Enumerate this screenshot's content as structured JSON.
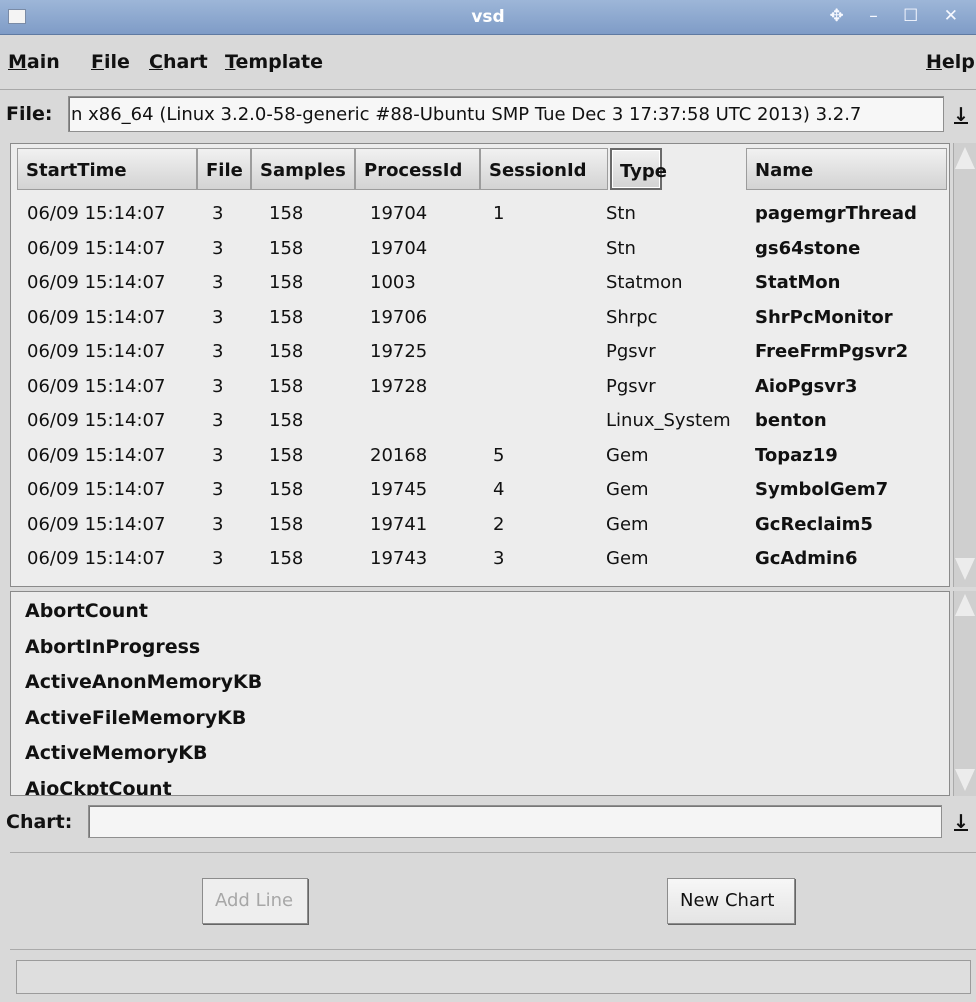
{
  "window": {
    "title": "vsd",
    "controls": "✥ – ☐ ✕",
    "icon": "window-icon"
  },
  "menubar": {
    "items": [
      "Main",
      "File",
      "Chart",
      "Template"
    ],
    "help": "Help"
  },
  "file_selector": {
    "label": "File:",
    "value": "n x86_64 (Linux 3.2.0-58-generic #88-Ubuntu SMP Tue Dec 3 17:37:58 UTC 2013) 3.2.7",
    "drop_icon": "download-arrow-icon"
  },
  "process_table": {
    "columns": [
      "StartTime",
      "File",
      "Samples",
      "ProcessId",
      "SessionId",
      "Type",
      "Name"
    ],
    "rows": [
      [
        "06/09 15:14:07",
        "3",
        "158",
        "19704",
        "1",
        "Stn",
        "pagemgrThread"
      ],
      [
        "06/09 15:14:07",
        "3",
        "158",
        "19704",
        "",
        "Stn",
        "gs64stone"
      ],
      [
        "06/09 15:14:07",
        "3",
        "158",
        "1003",
        "",
        "Statmon",
        "StatMon"
      ],
      [
        "06/09 15:14:07",
        "3",
        "158",
        "19706",
        "",
        "Shrpc",
        "ShrPcMonitor"
      ],
      [
        "06/09 15:14:07",
        "3",
        "158",
        "19725",
        "",
        "Pgsvr",
        "FreeFrmPgsvr2"
      ],
      [
        "06/09 15:14:07",
        "3",
        "158",
        "19728",
        "",
        "Pgsvr",
        "AioPgsvr3"
      ],
      [
        "06/09 15:14:07",
        "3",
        "158",
        "",
        "",
        "Linux_System",
        "benton"
      ],
      [
        "06/09 15:14:07",
        "3",
        "158",
        "20168",
        "5",
        "Gem",
        "Topaz19"
      ],
      [
        "06/09 15:14:07",
        "3",
        "158",
        "19745",
        "4",
        "Gem",
        "SymbolGem7"
      ],
      [
        "06/09 15:14:07",
        "3",
        "158",
        "19741",
        "2",
        "Gem",
        "GcReclaim5"
      ],
      [
        "06/09 15:14:07",
        "3",
        "158",
        "19743",
        "3",
        "Gem",
        "GcAdmin6"
      ]
    ]
  },
  "stat_list": {
    "items": [
      "AbortCount",
      "AbortInProgress",
      "ActiveAnonMemoryKB",
      "ActiveFileMemoryKB",
      "ActiveMemoryKB",
      "AioCkptCount"
    ]
  },
  "chart_selector": {
    "label": "Chart:",
    "value": ""
  },
  "buttons": {
    "add_line": "Add Line",
    "new_chart": "New Chart"
  },
  "status_bar": {
    "text": ""
  }
}
